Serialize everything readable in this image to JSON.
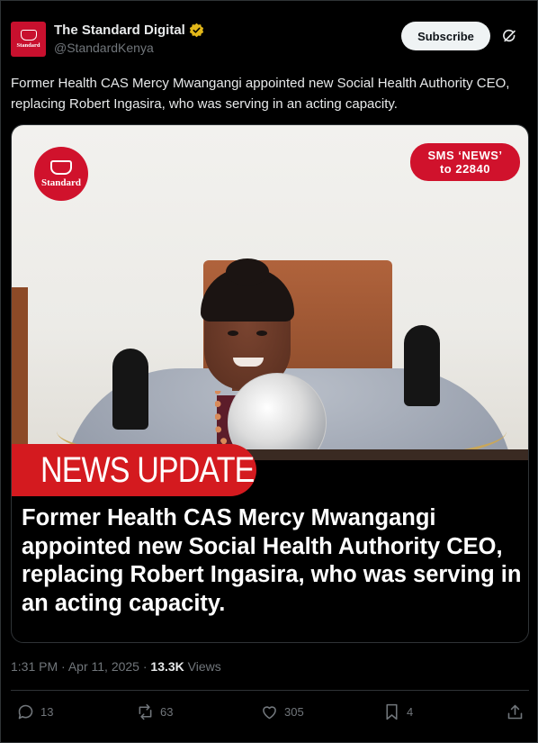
{
  "account": {
    "display_name": "The Standard Digital",
    "handle": "@StandardKenya",
    "avatar_text": "Standard"
  },
  "header": {
    "subscribe_label": "Subscribe"
  },
  "tweet": {
    "text": "Former Health CAS Mercy Mwangangi appointed new Social Health Authority CEO, replacing Robert Ingasira, who was serving in an acting capacity."
  },
  "media": {
    "logo_text": "Standard",
    "sms_line1": "SMS ‘NEWS’",
    "sms_line2": "to 22840",
    "banner": "NEWS UPDATE",
    "headline": "Former Health CAS Mercy Mwangangi appointed new Social Health Authority CEO, replacing Robert Ingasira, who was serving in an acting capacity."
  },
  "meta": {
    "time": "1:31 PM",
    "separator": "·",
    "date": "Apr 11, 2025",
    "views_count": "13.3K",
    "views_label": "Views"
  },
  "actions": {
    "replies": "13",
    "reposts": "63",
    "likes": "305",
    "bookmarks": "4"
  },
  "colors": {
    "background": "#000000",
    "text": "#e7e9ea",
    "muted": "#71767b",
    "brand_red": "#d0122c",
    "verified_gold": "#e2b719"
  },
  "icons": [
    "verified-badge-icon",
    "grok-icon",
    "reply-icon",
    "repost-icon",
    "like-icon",
    "bookmark-icon",
    "share-icon"
  ]
}
